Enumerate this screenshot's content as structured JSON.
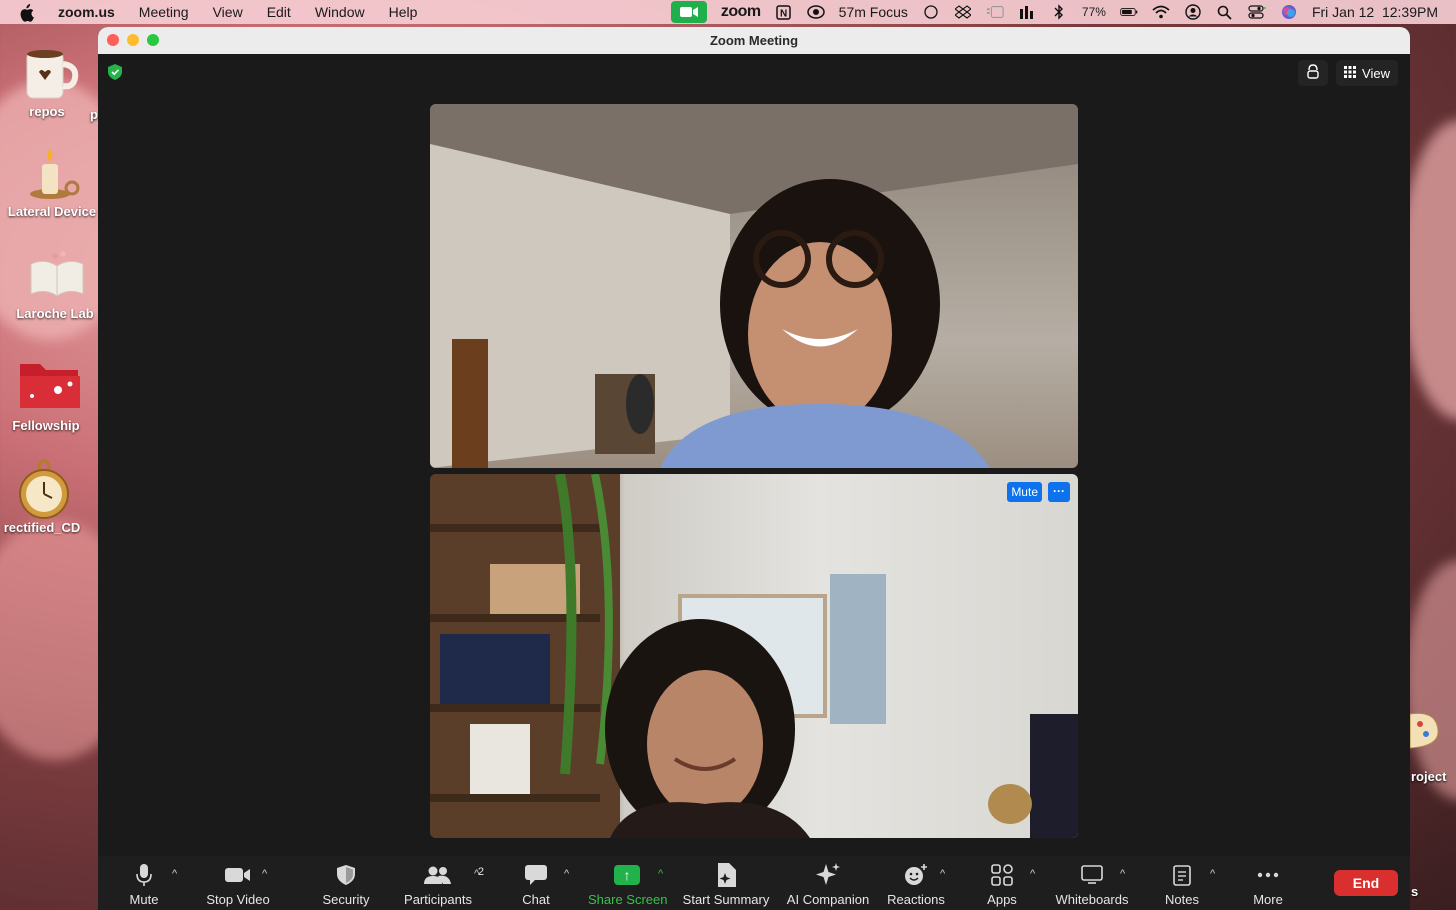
{
  "menubar": {
    "app_name": "zoom.us",
    "menus": [
      "Meeting",
      "View",
      "Edit",
      "Window",
      "Help"
    ],
    "zoom_brand": "zoom",
    "focus_status": "57m Focus",
    "battery": "77%",
    "datetime": "Fri Jan 12  12:39PM"
  },
  "desktop": {
    "icons": [
      {
        "label": "repos"
      },
      {
        "label": "Lateral Device"
      },
      {
        "label": "Laroche Lab"
      },
      {
        "label": "Fellowship"
      },
      {
        "label": "rectified_CD"
      }
    ],
    "partial_labels": [
      "p",
      "roject",
      "s"
    ]
  },
  "window": {
    "title": "Zoom Meeting",
    "view_label": "View"
  },
  "tile2": {
    "mute_label": "Mute",
    "more_label": "···"
  },
  "toolbar": {
    "mute": "Mute",
    "stop_video": "Stop Video",
    "security": "Security",
    "participants": "Participants",
    "participants_count": "2",
    "chat": "Chat",
    "share_screen": "Share Screen",
    "start_summary": "Start Summary",
    "ai_companion": "AI Companion",
    "reactions": "Reactions",
    "apps": "Apps",
    "whiteboards": "Whiteboards",
    "notes": "Notes",
    "more": "More",
    "end": "End"
  },
  "colors": {
    "accent_blue": "#0e72ed",
    "share_green": "#21b24c",
    "end_red": "#d9302f"
  }
}
